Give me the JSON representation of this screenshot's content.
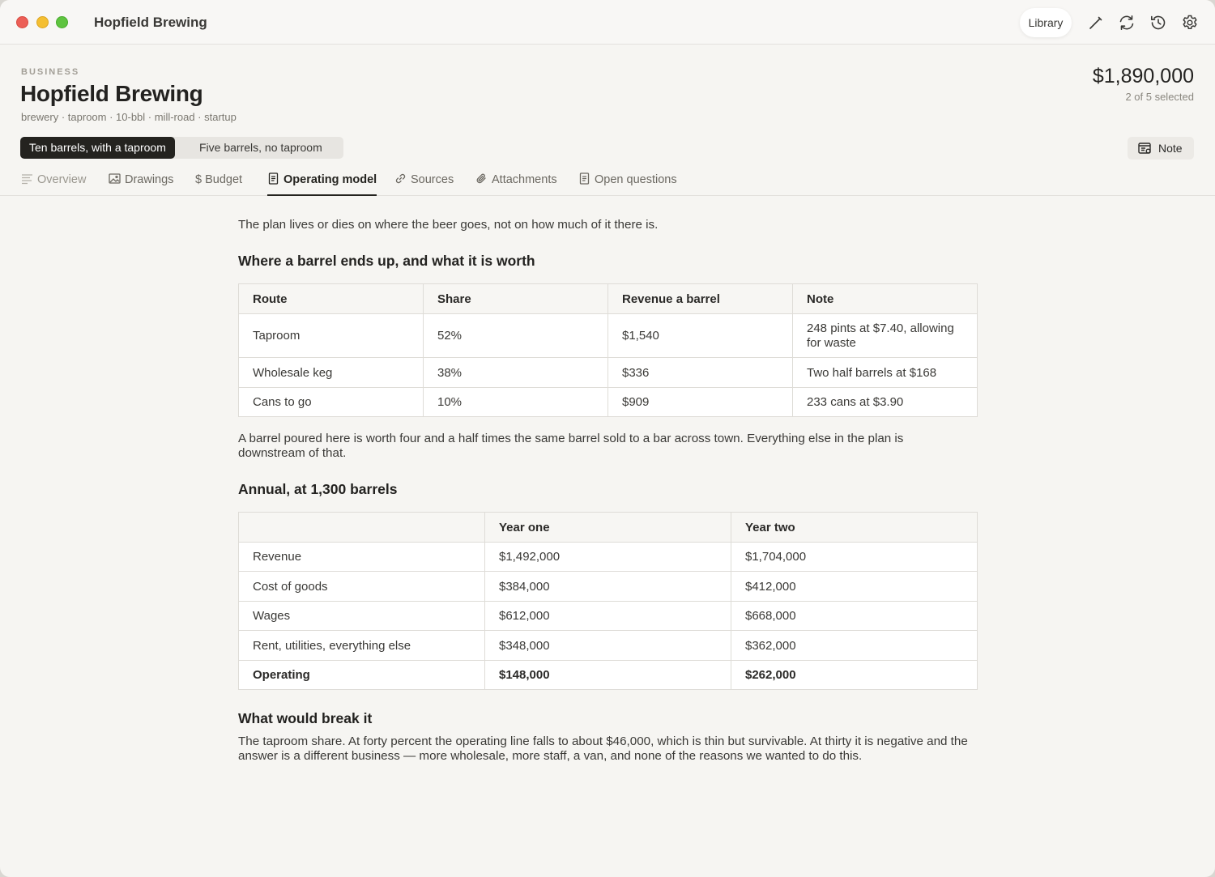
{
  "titlebar": {
    "app_title": "Hopfield Brewing",
    "library_label": "Library"
  },
  "header": {
    "eyebrow": "BUSINESS",
    "title": "Hopfield Brewing",
    "tags": "brewery · taproom · 10-bbl · mill-road · startup",
    "total": "$1,890,000",
    "selected": "2 of 5 selected"
  },
  "scenarios": [
    {
      "label": "Ten barrels, with a taproom",
      "active": true
    },
    {
      "label": "Five barrels, no taproom",
      "active": false
    }
  ],
  "note_button": "Note",
  "tabs": [
    {
      "label": "Overview",
      "icon": "lines-icon"
    },
    {
      "label": "Drawings",
      "icon": "image-icon"
    },
    {
      "label": "Budget",
      "icon": "dollar-icon"
    },
    {
      "label": "Operating model",
      "icon": "document-icon",
      "active": true
    },
    {
      "label": "Sources",
      "icon": "link-icon"
    },
    {
      "label": "Attachments",
      "icon": "paperclip-icon"
    },
    {
      "label": "Open questions",
      "icon": "document-icon"
    }
  ],
  "content": {
    "intro": "The plan lives or dies on where the beer goes, not on how much of it there is.",
    "section1_heading": "Where a barrel ends up, and what it is worth",
    "routes_table": {
      "headers": [
        "Route",
        "Share",
        "Revenue a barrel",
        "Note"
      ],
      "rows": [
        [
          "Taproom",
          "52%",
          "$1,540",
          "248 pints at $7.40, allowing for waste"
        ],
        [
          "Wholesale keg",
          "38%",
          "$336",
          "Two half barrels at $168"
        ],
        [
          "Cans to go",
          "10%",
          "$909",
          "233 cans at $3.90"
        ]
      ]
    },
    "section1_note": "A barrel poured here is worth four and a half times the same barrel sold to a bar across town. Everything else in the plan is downstream of that.",
    "section2_heading": "Annual, at 1,300 barrels",
    "annual_table": {
      "headers": [
        "",
        "Year one",
        "Year two"
      ],
      "rows": [
        [
          "Revenue",
          "$1,492,000",
          "$1,704,000"
        ],
        [
          "Cost of goods",
          "$384,000",
          "$412,000"
        ],
        [
          "Wages",
          "$612,000",
          "$668,000"
        ],
        [
          "Rent, utilities, everything else",
          "$348,000",
          "$362,000"
        ],
        [
          "Operating",
          "$148,000",
          "$262,000"
        ]
      ]
    },
    "section3_heading": "What would break it",
    "section3_text": "The taproom share. At forty percent the operating line falls to about $46,000, which is thin but survivable. At thirty it is negative and the answer is a different business — more wholesale, more staff, a van, and none of the reasons we wanted to do this."
  },
  "colors": {
    "background": "#f6f5f2",
    "active_scenario": "#24231f",
    "text": "#2b2a28"
  }
}
